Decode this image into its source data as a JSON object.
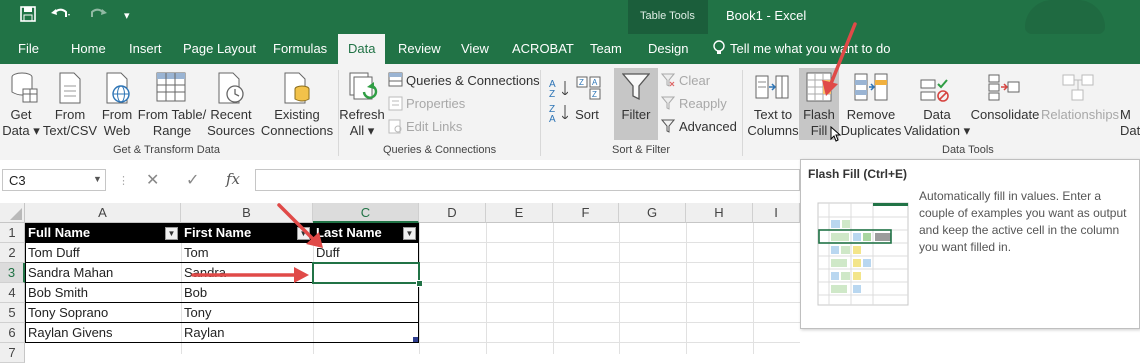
{
  "app": {
    "document_title": "Book1 - Excel",
    "context_tab_group": "Table Tools"
  },
  "tabs": [
    "File",
    "Home",
    "Insert",
    "Page Layout",
    "Formulas",
    "Data",
    "Review",
    "View",
    "ACROBAT",
    "Team",
    "Design"
  ],
  "active_tab": "Data",
  "tell_me": "Tell me what you want to do",
  "ribbon": {
    "get_transform": {
      "get_data": [
        "Get",
        "Data ▾"
      ],
      "from_text": [
        "From",
        "Text/CSV"
      ],
      "from_web": [
        "From",
        "Web"
      ],
      "from_table": [
        "From Table/",
        "Range"
      ],
      "recent_sources": [
        "Recent",
        "Sources"
      ],
      "existing_connections": [
        "Existing",
        "Connections"
      ],
      "label": "Get & Transform Data"
    },
    "queries": {
      "refresh_all": [
        "Refresh",
        "All ▾"
      ],
      "queries_connections": "Queries & Connections",
      "properties": "Properties",
      "edit_links": "Edit Links",
      "label": "Queries & Connections"
    },
    "sort_filter": {
      "sort_az": "A Z",
      "sort_za": "Z A",
      "sort": "Sort",
      "filter": "Filter",
      "clear": "Clear",
      "reapply": "Reapply",
      "advanced": "Advanced",
      "label": "Sort & Filter"
    },
    "data_tools": {
      "text_to_columns": [
        "Text to",
        "Columns"
      ],
      "flash_fill": [
        "Flash",
        "Fill"
      ],
      "remove_duplicates": [
        "Remove",
        "Duplicates"
      ],
      "data_validation": [
        "Data",
        "Validation ▾"
      ],
      "consolidate": "Consolidate",
      "relationships": "Relationships",
      "more": [
        "M",
        "Dat"
      ],
      "label": "Data Tools"
    }
  },
  "formula_bar": {
    "name_box": "C3",
    "fx": "fx",
    "cancel": "✕",
    "enter": "✓",
    "content": ""
  },
  "columns": [
    "A",
    "B",
    "C",
    "D",
    "E",
    "F",
    "G",
    "H",
    "I"
  ],
  "rows": [
    "1",
    "2",
    "3",
    "4",
    "5",
    "6",
    "7"
  ],
  "table": {
    "headers": [
      "Full Name",
      "First Name",
      "Last Name"
    ],
    "data": [
      [
        "Tom Duff",
        "Tom",
        "Duff"
      ],
      [
        "Sandra Mahan",
        "Sandra",
        ""
      ],
      [
        "Bob Smith",
        "Bob",
        ""
      ],
      [
        "Tony Soprano",
        "Tony",
        ""
      ],
      [
        "Raylan Givens",
        "Raylan",
        ""
      ]
    ]
  },
  "tooltip": {
    "title": "Flash Fill (Ctrl+E)",
    "body": "Automatically fill in values. Enter a couple of examples you want as output and keep the active cell in the column you want filled in."
  },
  "colors": {
    "excel_green": "#217346",
    "arrow_red": "#e04a48",
    "table_header": "#000000"
  }
}
